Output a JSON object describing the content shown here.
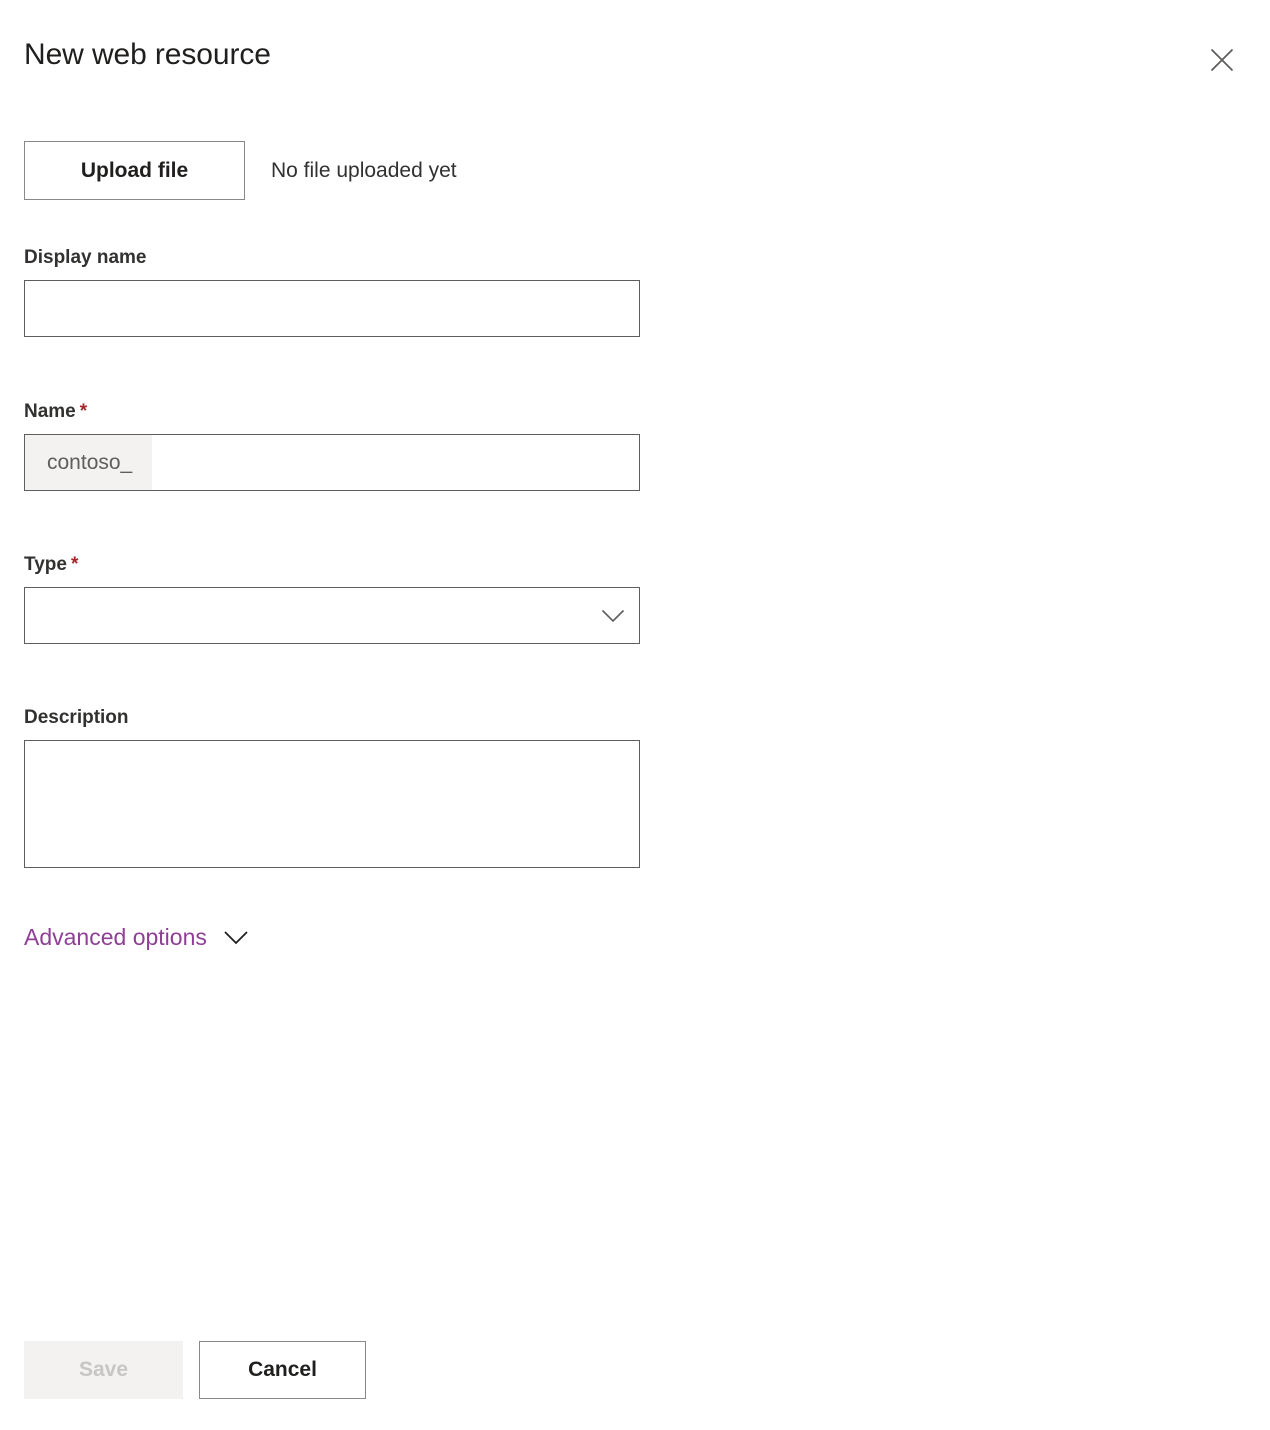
{
  "header": {
    "title": "New web resource",
    "close_label": "Close",
    "close_icon": "close-icon"
  },
  "upload": {
    "button_label": "Upload file",
    "status_text": "No file uploaded yet"
  },
  "form": {
    "display_name": {
      "label": "Display name",
      "value": "",
      "placeholder": ""
    },
    "name": {
      "label": "Name",
      "required_marker": "*",
      "prefix": "contoso_",
      "value": "",
      "placeholder": ""
    },
    "type": {
      "label": "Type",
      "required_marker": "*",
      "value": "",
      "placeholder": "",
      "chevron_icon": "chevron-down-icon"
    },
    "description": {
      "label": "Description",
      "value": "",
      "placeholder": ""
    }
  },
  "advanced": {
    "label": "Advanced options",
    "chevron_icon": "chevron-down-icon"
  },
  "footer": {
    "save_label": "Save",
    "cancel_label": "Cancel"
  },
  "colors": {
    "link_purple": "#8f3f97",
    "required_red": "#a4262c",
    "border_gray": "#605e5c",
    "button_border": "#8a8886",
    "disabled_bg": "#f3f2f1",
    "disabled_text": "#c8c6c4",
    "prefix_bg": "#f3f2f1",
    "title_text": "#201f1e"
  }
}
